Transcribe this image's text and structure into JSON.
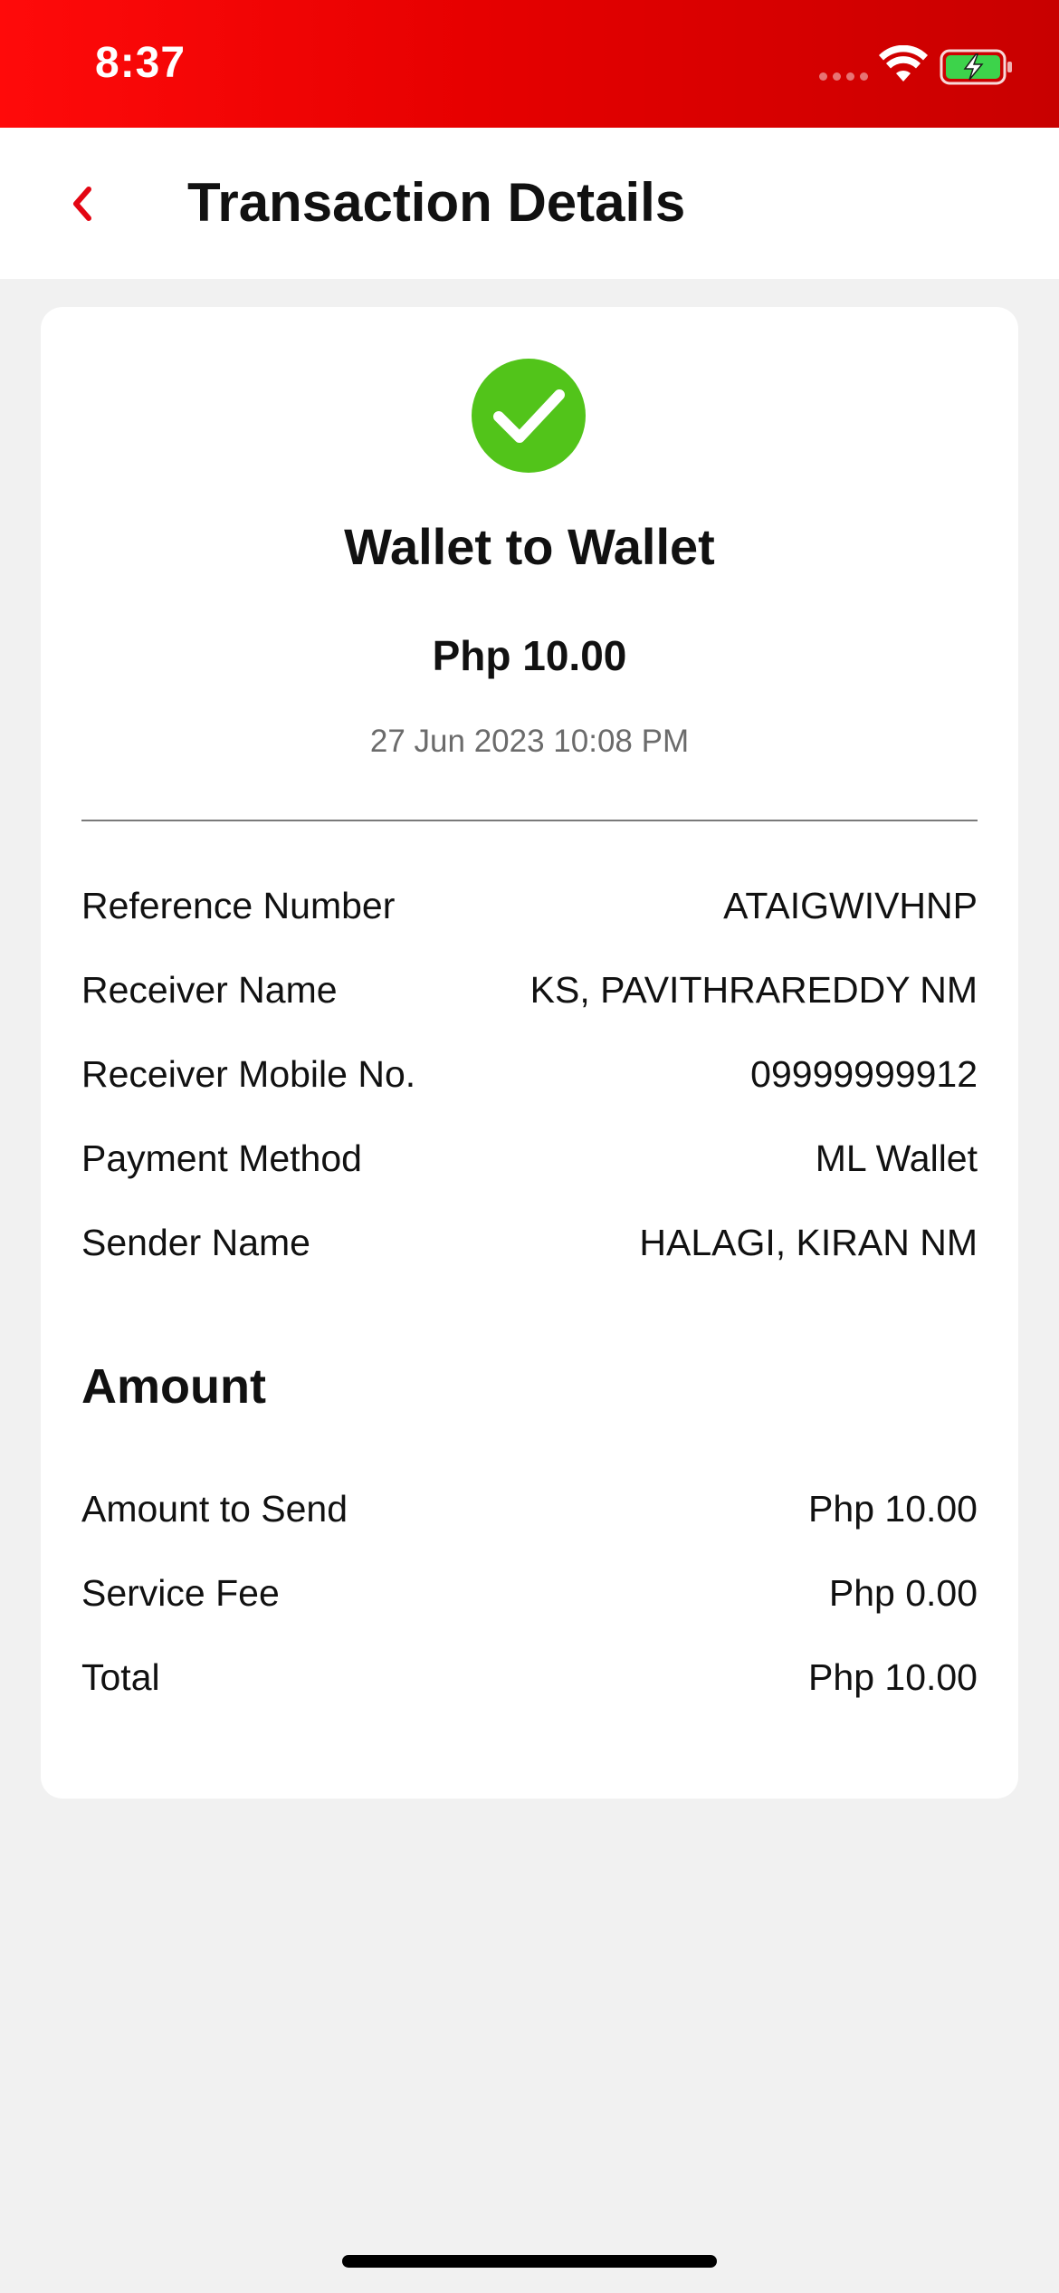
{
  "status_bar": {
    "time": "8:37",
    "signal_icon": "cellular-signal-icon",
    "wifi_icon": "wifi-icon",
    "battery_icon": "battery-charging-icon",
    "background_colors": [
      "#ff0a0a",
      "#c80000"
    ]
  },
  "nav": {
    "title": "Transaction Details",
    "back_icon": "chevron-left-icon",
    "accent_color": "#e30613"
  },
  "transaction": {
    "status_icon": "success-check-icon",
    "status_color": "#52c41a",
    "type": "Wallet to Wallet",
    "amount": "Php 10.00",
    "date": "27 Jun 2023 10:08 PM"
  },
  "details": [
    {
      "label": "Reference Number",
      "value": "ATAIGWIVHNP"
    },
    {
      "label": "Receiver Name",
      "value": "KS, PAVITHRAREDDY NM"
    },
    {
      "label": "Receiver Mobile No.",
      "value": "09999999912"
    },
    {
      "label": "Payment Method",
      "value": "ML Wallet"
    },
    {
      "label": "Sender Name",
      "value": "HALAGI, KIRAN NM"
    }
  ],
  "amount_section": {
    "title": "Amount",
    "rows": [
      {
        "label": "Amount to Send",
        "value": "Php 10.00"
      },
      {
        "label": "Service Fee",
        "value": "Php 0.00"
      },
      {
        "label": "Total",
        "value": "Php 10.00"
      }
    ]
  }
}
